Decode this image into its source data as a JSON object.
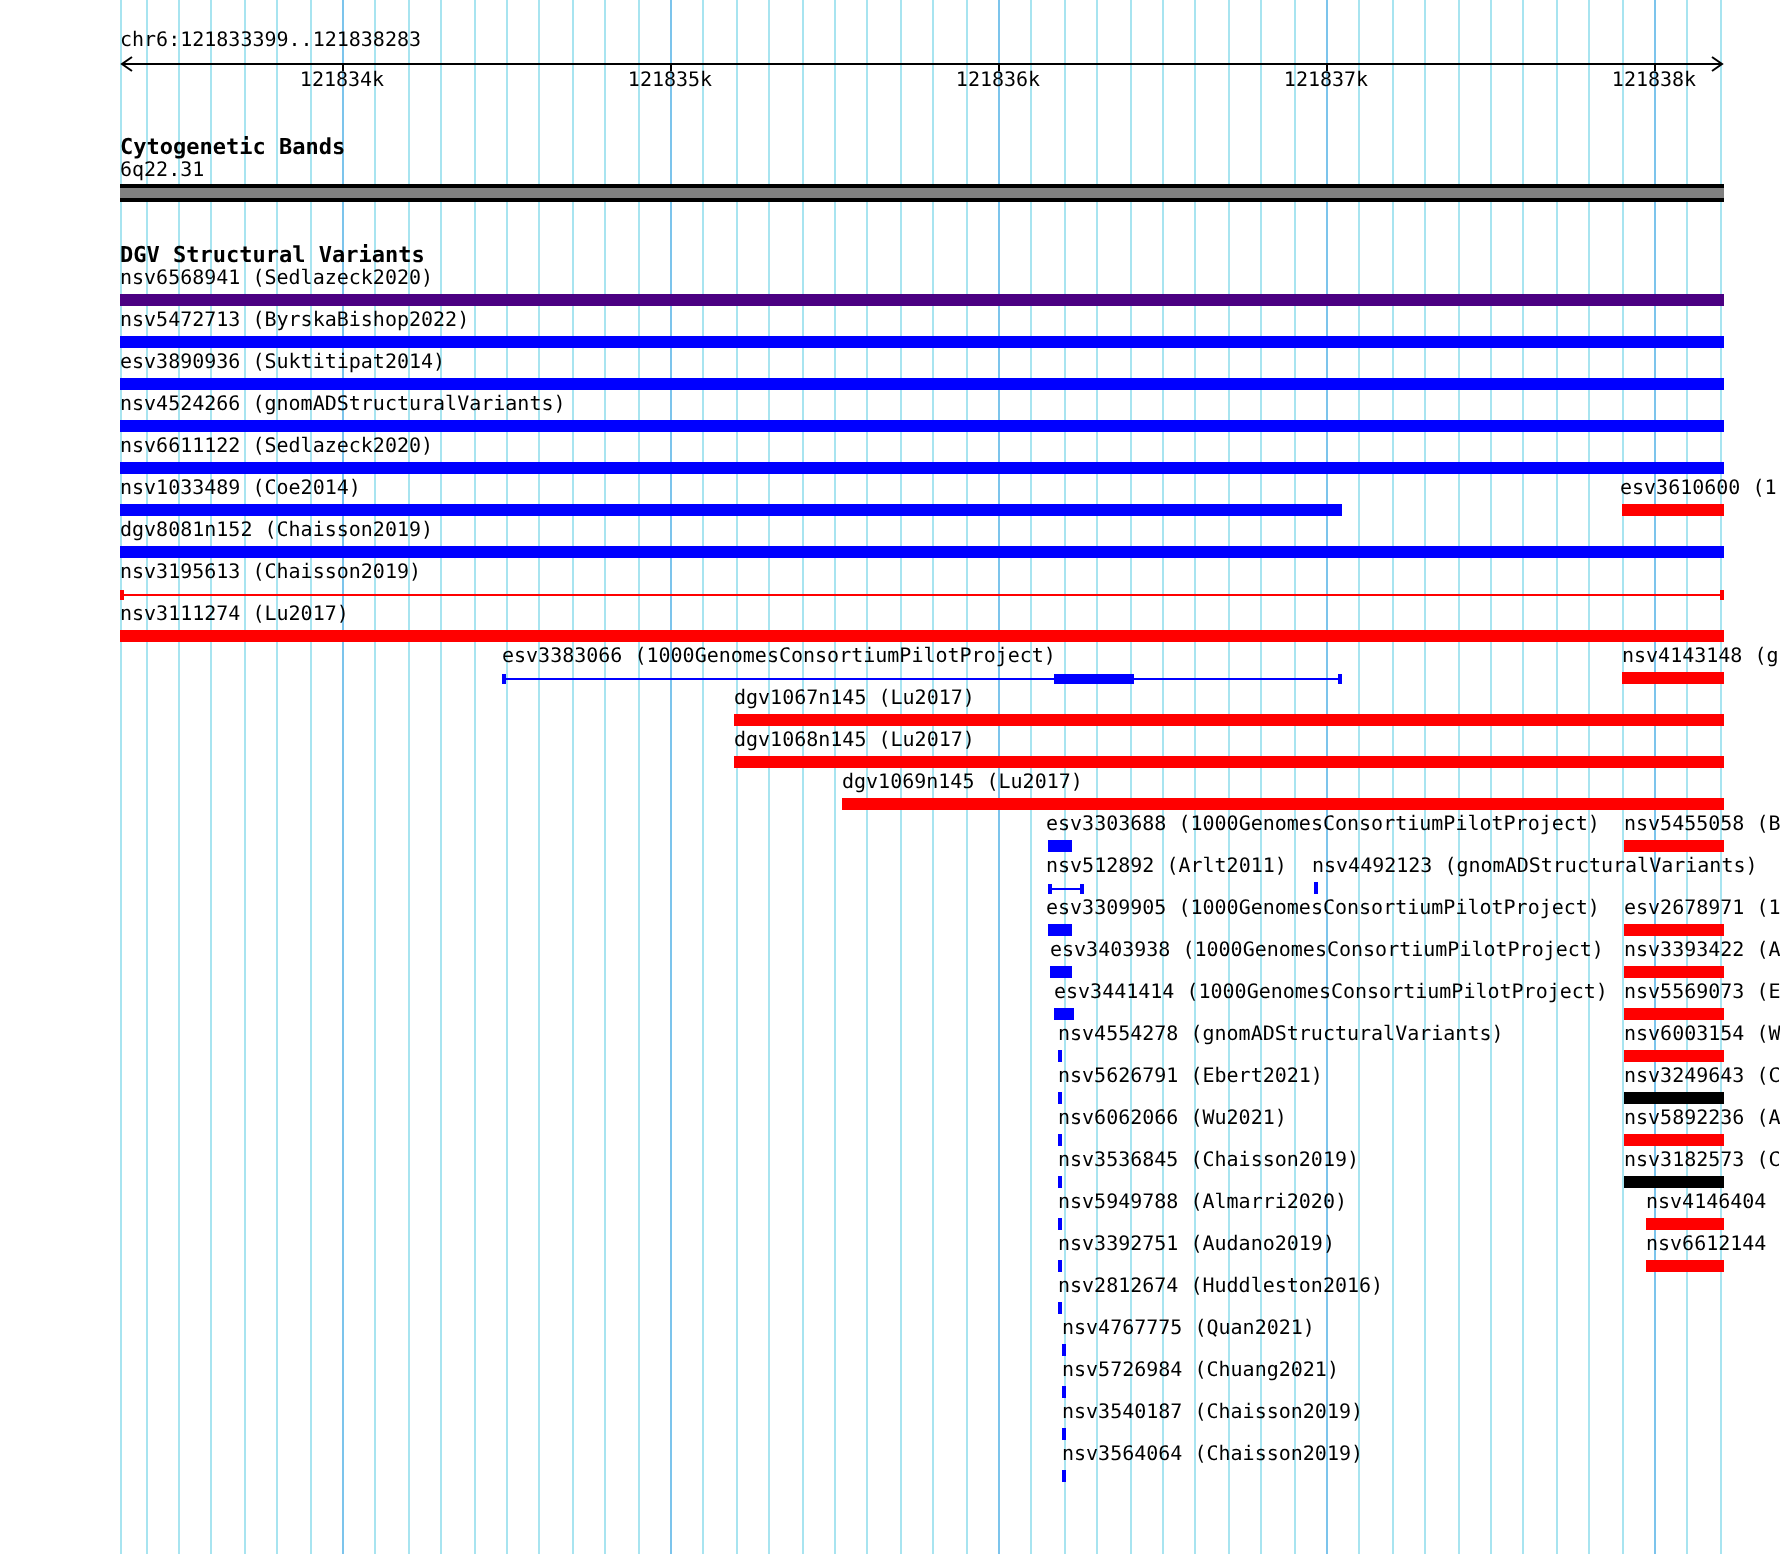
{
  "ruler": {
    "location": "chr6:121833399..121838283",
    "ticks": [
      "121834k",
      "121835k",
      "121836k",
      "121837k",
      "121838k"
    ]
  },
  "cytogenetic_bands": {
    "title": "Cytogenetic Bands",
    "band": {
      "label": "6q22.31"
    }
  },
  "dgv_structural_variants": {
    "title": "DGV Structural Variants",
    "variants": [
      {
        "label": "nsv6568941 (Sedlazeck2020)",
        "color": "#4b0082",
        "kind": "bar"
      },
      {
        "label": "nsv5472713 (ByrskaBishop2022)",
        "color": "#0000ff",
        "kind": "bar"
      },
      {
        "label": "esv3890936 (Suktitipat2014)",
        "color": "#0000ff",
        "kind": "bar"
      },
      {
        "label": "nsv4524266 (gnomADStructuralVariants)",
        "color": "#0000ff",
        "kind": "bar"
      },
      {
        "label": "nsv6611122 (Sedlazeck2020)",
        "color": "#0000ff",
        "kind": "bar"
      },
      {
        "label": "nsv1033489 (Coe2014)",
        "color": "#0000ff",
        "kind": "bar"
      },
      {
        "label": "esv3610600 (1",
        "color": "#ff0000",
        "kind": "bar"
      },
      {
        "label": "dgv8081n152 (Chaisson2019)",
        "color": "#0000ff",
        "kind": "bar"
      },
      {
        "label": "nsv3195613 (Chaisson2019)",
        "color": "#ff0000",
        "kind": "line"
      },
      {
        "label": "nsv3111274 (Lu2017)",
        "color": "#ff0000",
        "kind": "bar"
      },
      {
        "label": "esv3383066 (1000GenomesConsortiumPilotProject)",
        "color": "#0000ff",
        "kind": "gapped"
      },
      {
        "label": "nsv4143148 (g",
        "color": "#ff0000",
        "kind": "bar"
      },
      {
        "label": "dgv1067n145 (Lu2017)",
        "color": "#ff0000",
        "kind": "bar"
      },
      {
        "label": "dgv1068n145 (Lu2017)",
        "color": "#ff0000",
        "kind": "bar"
      },
      {
        "label": "dgv1069n145 (Lu2017)",
        "color": "#ff0000",
        "kind": "bar"
      },
      {
        "label": "esv3303688 (1000GenomesConsortiumPilotProject)",
        "color": "#0000ff",
        "kind": "bar"
      },
      {
        "label": "nsv5455058 (B",
        "color": "#ff0000",
        "kind": "bar"
      },
      {
        "label": "nsv512892 (Arlt2011)",
        "color": "#0000ff",
        "kind": "line"
      },
      {
        "label": "nsv4492123 (gnomADStructuralVariants)",
        "color": "#0000ff",
        "kind": "bar"
      },
      {
        "label": "esv3309905 (1000GenomesConsortiumPilotProject)",
        "color": "#0000ff",
        "kind": "bar"
      },
      {
        "label": "esv2678971 (1",
        "color": "#ff0000",
        "kind": "bar"
      },
      {
        "label": "esv3403938 (1000GenomesConsortiumPilotProject)",
        "color": "#0000ff",
        "kind": "bar"
      },
      {
        "label": "nsv3393422 (A",
        "color": "#ff0000",
        "kind": "bar"
      },
      {
        "label": "esv3441414 (1000GenomesConsortiumPilotProject)",
        "color": "#0000ff",
        "kind": "bar"
      },
      {
        "label": "nsv5569073 (E",
        "color": "#ff0000",
        "kind": "bar"
      },
      {
        "label": "nsv4554278 (gnomADStructuralVariants)",
        "color": "#0000ff",
        "kind": "bar"
      },
      {
        "label": "nsv6003154 (W",
        "color": "#ff0000",
        "kind": "bar"
      },
      {
        "label": "nsv5626791 (Ebert2021)",
        "color": "#0000ff",
        "kind": "bar"
      },
      {
        "label": "nsv3249643 (C",
        "color": "#000000",
        "kind": "bar"
      },
      {
        "label": "nsv6062066 (Wu2021)",
        "color": "#0000ff",
        "kind": "bar"
      },
      {
        "label": "nsv5892236 (A",
        "color": "#ff0000",
        "kind": "bar"
      },
      {
        "label": "nsv3536845 (Chaisson2019)",
        "color": "#0000ff",
        "kind": "bar"
      },
      {
        "label": "nsv3182573 (C",
        "color": "#000000",
        "kind": "bar"
      },
      {
        "label": "nsv5949788 (Almarri2020)",
        "color": "#0000ff",
        "kind": "bar"
      },
      {
        "label": "nsv4146404",
        "color": "#ff0000",
        "kind": "bar"
      },
      {
        "label": "nsv3392751 (Audano2019)",
        "color": "#0000ff",
        "kind": "bar"
      },
      {
        "label": "nsv6612144",
        "color": "#ff0000",
        "kind": "bar"
      },
      {
        "label": "nsv2812674 (Huddleston2016)",
        "color": "#0000ff",
        "kind": "bar"
      },
      {
        "label": "nsv4767775 (Quan2021)",
        "color": "#0000ff",
        "kind": "bar"
      },
      {
        "label": "nsv5726984 (Chuang2021)",
        "color": "#0000ff",
        "kind": "bar"
      },
      {
        "label": "nsv3540187 (Chaisson2019)",
        "color": "#0000ff",
        "kind": "bar"
      },
      {
        "label": "nsv3564064 (Chaisson2019)",
        "color": "#0000ff",
        "kind": "bar"
      }
    ]
  }
}
